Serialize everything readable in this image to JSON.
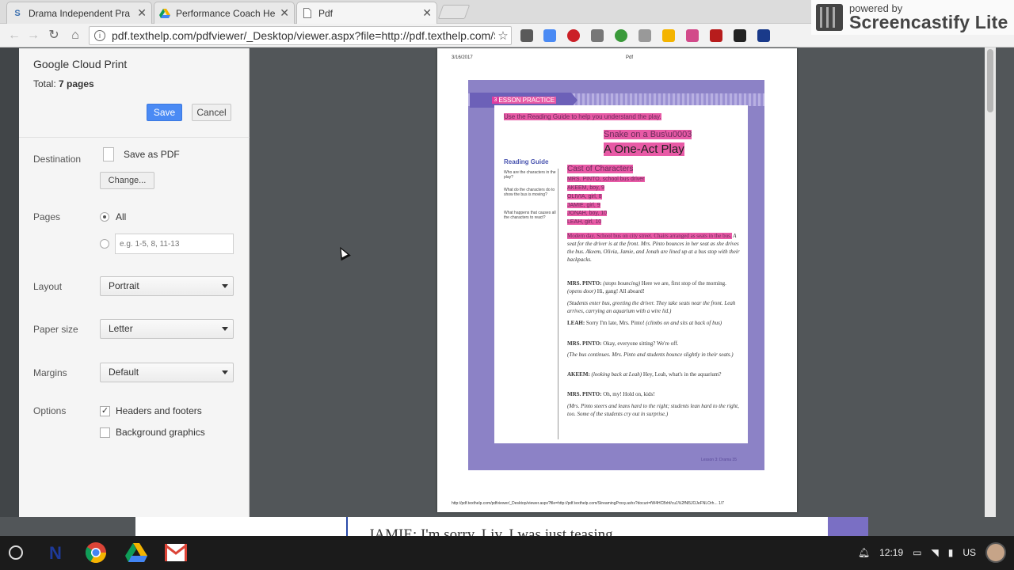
{
  "browser": {
    "tabs": [
      {
        "label": "Drama Independent Pra",
        "icon": "s-logo"
      },
      {
        "label": "Performance Coach Hel",
        "icon": "drive"
      },
      {
        "label": "Pdf",
        "icon": "page"
      }
    ],
    "url": "pdf.texthelp.com/pdfviewer/_Desktop/viewer.aspx?file=http://pdf.texthelp.com/St"
  },
  "screencastify": {
    "line1": "powered by",
    "line2": "Screencastify Lite"
  },
  "print_dialog": {
    "title": "Google Cloud Print",
    "total_prefix": "Total: ",
    "total_value": "7 pages",
    "save_label": "Save",
    "cancel_label": "Cancel",
    "destination_label": "Destination",
    "destination_value": "Save as PDF",
    "change_label": "Change...",
    "pages_label": "Pages",
    "pages_all": "All",
    "pages_placeholder": "e.g. 1-5, 8, 11-13",
    "layout_label": "Layout",
    "layout_value": "Portrait",
    "paper_label": "Paper size",
    "paper_value": "Letter",
    "margins_label": "Margins",
    "margins_value": "Default",
    "options_label": "Options",
    "opt_headers": "Headers and footers",
    "opt_headers_checked": true,
    "opt_background": "Background graphics",
    "opt_background_checked": false
  },
  "preview": {
    "header_left": "3/16/2017",
    "header_center": "Pdf",
    "tag": "LESSON PRACTICE",
    "tag_num": "3",
    "instructions": "Use the Reading Guide to help you understand the play.",
    "subtitle": "Snake on a Bus\\u0003",
    "title": "A One-Act Play",
    "reading_guide": "Reading Guide",
    "q1": "Who are the characters in the play?",
    "q2": "What do the characters do to show the bus is moving?",
    "q3": "What happens that causes all the characters to react?",
    "cast_heading": "Cast of Characters",
    "cast": [
      "MRS. PINTO, school bus driver",
      "AKEEM, boy, 9",
      "OLIVIA, girl, 8",
      "JAMIE, girl, 9",
      "JONAH, boy, 10",
      "LEAH, girl, 10"
    ],
    "setting_hl": "Modern day. School bus on city street. Chairs arranged as seats in the bus.",
    "setting_rest": " A seat for the driver is at the front. Mrs. Pinto bounces in her seat as she drives the bus. Akeem, Olivia, Jamie, and Jonah are lined up at a bus stop with their backpacks.",
    "lines": [
      {
        "speaker": "MRS. PINTO:",
        "dir": "(stops bouncing)",
        "text": " Here we are, first stop of the morning. ",
        "dir2": "(opens door)",
        "text2": " Hi, gang! All aboard!"
      },
      {
        "speaker": "",
        "dir": "(Students enter bus, greeting the driver. They take seats near the front. Leah arrives, carrying an aquarium with a wire lid.)",
        "text": "",
        "dir2": "",
        "text2": ""
      },
      {
        "speaker": "LEAH:",
        "dir": "",
        "text": " Sorry I'm late, Mrs. Pinto! ",
        "dir2": "(climbs on and sits at back of bus)",
        "text2": ""
      },
      {
        "speaker": "MRS. PINTO:",
        "dir": "",
        "text": " Okay, everyone sitting? We're off.",
        "dir2": "",
        "text2": ""
      },
      {
        "speaker": "",
        "dir": "(The bus continues. Mrs. Pinto and students bounce slightly in their seats.)",
        "text": "",
        "dir2": "",
        "text2": ""
      },
      {
        "speaker": "AKEEM:",
        "dir": "(looking back at Leah)",
        "text": " Hey, Leah, what's in the aquarium?",
        "dir2": "",
        "text2": ""
      },
      {
        "speaker": "MRS. PINTO:",
        "dir": "",
        "text": " Oh, my! Hold on, kids!",
        "dir2": "",
        "text2": ""
      },
      {
        "speaker": "",
        "dir": "(Mrs. Pinto steers and leans hard to the right; students lean hard to the right, too. Some of the students cry out in surprise.)",
        "text": "",
        "dir2": "",
        "text2": ""
      }
    ],
    "footer": "Lesson 3: Drama   35",
    "url_footer": "http://pdf.texthelp.com/pdfviewer/_Desktop/viewer.aspx?file=http://pdf.texthelp.com/StreamingProxy.ashx?docuri=fW4HCBrhf/cu1%2fNl5JOJeFNLOrh...   1/7"
  },
  "background_doc": {
    "text": "JAMIE: I'm sorry, Liv. I was just teasing."
  },
  "shelf": {
    "time": "12:19",
    "keyboard": "US"
  }
}
